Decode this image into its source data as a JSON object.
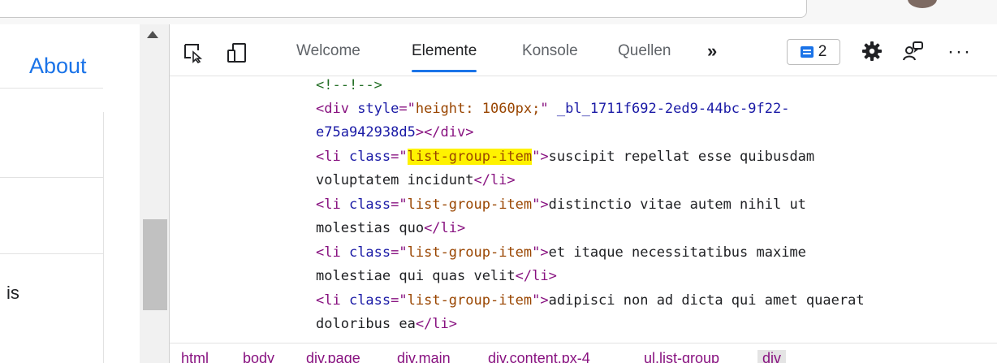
{
  "page": {
    "nav_about": "About",
    "partial_word": "is"
  },
  "devtools": {
    "tabs": [
      {
        "label": "Welcome"
      },
      {
        "label": "Elemente"
      },
      {
        "label": "Konsole"
      },
      {
        "label": "Quellen"
      }
    ],
    "more_tabs": "»",
    "issues_count": "2",
    "more_menu": "···",
    "code": {
      "l0": "<!--!-->",
      "l1_a": "<div ",
      "l1_b": "style",
      "l1_c": "=\"",
      "l1_d": "height: 1060px;",
      "l1_e": "\" ",
      "l1_f": "_bl_1711f692-2ed9-44bc-9f22-",
      "l2_a": "e75a942938d5",
      "l2_b": "></div>",
      "li_open": "<li ",
      "class_attr": "class",
      "eq_q": "=\"",
      "class_val": "list-group-item",
      "close_q": "\">",
      "li_close": "</li>",
      "t1a": "suscipit repellat esse quibusdam",
      "t1b": "voluptatem incidunt",
      "t2a": "distinctio vitae autem nihil ut",
      "t2b": "molestias quo",
      "t3a": "et itaque necessitatibus maxime",
      "t3b": "molestiae qui quas velit",
      "t4a": "adipisci non ad dicta qui amet quaerat",
      "t4b": "doloribus ea"
    },
    "breadcrumbs": [
      "html",
      "body",
      "div.page",
      "div.main",
      "div.content.px-4",
      "ul.list-group",
      "div"
    ]
  },
  "colors": {
    "accent": "#1a73e8",
    "tag": "#881280",
    "attr": "#1a1aa6",
    "value": "#994500",
    "comment": "#236e25",
    "highlight": "#fff200"
  }
}
